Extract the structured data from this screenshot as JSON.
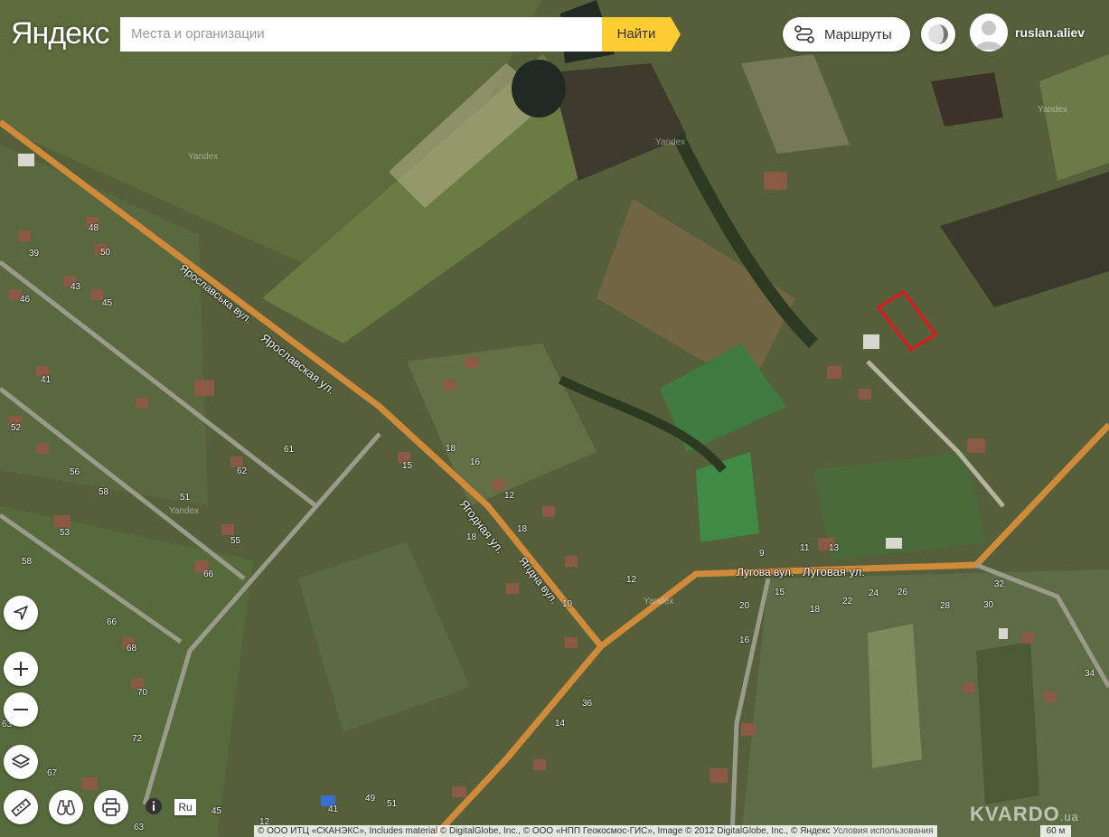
{
  "header": {
    "logo": "Яндекс",
    "search_placeholder": "Места и организации",
    "find_label": "Найти",
    "routes_label": "Маршруты",
    "username": "ruslan.aliev"
  },
  "map": {
    "streets": {
      "yaroslavska_uk": "Ярославська вул.",
      "yaroslavskaya_ru": "Ярославская ул.",
      "yagodnaya_ru": "Ягодная ул.",
      "yagidna_uk": "Ягідна вул.",
      "luhova_uk": "Лугова вул.",
      "lugovaya_ru": "Луговая ул."
    },
    "watermark": "Yandex",
    "house_numbers": [
      "39",
      "48",
      "50",
      "46",
      "43",
      "45",
      "41",
      "52",
      "56",
      "58",
      "51",
      "62",
      "61",
      "55",
      "66",
      "53",
      "58",
      "66",
      "68",
      "70",
      "72",
      "63",
      "67",
      "18",
      "15",
      "16",
      "18",
      "12",
      "18",
      "10",
      "12",
      "9",
      "11",
      "13",
      "15",
      "20",
      "16",
      "18",
      "22",
      "24",
      "26",
      "28",
      "30",
      "32",
      "34",
      "36",
      "14",
      "12",
      "45",
      "41",
      "49",
      "51",
      "63",
      "18"
    ]
  },
  "controls": {
    "locate_icon": "arrow-icon",
    "zoom_in": "+",
    "zoom_out": "−",
    "layers_icon": "layers-icon",
    "ruler_icon": "ruler-icon",
    "panorama_icon": "binoculars-icon",
    "print_icon": "printer-icon",
    "info_icon": "info-icon",
    "lang": "Ru"
  },
  "footer": {
    "copyright": "© ООО ИТЦ «СКАНЭКС», Includes material © DigitalGlobe, Inc., © ООО «НПП Геокосмос-ГИС», Image © 2012 DigitalGlobe, Inc., © Яндекс",
    "terms": "Условия использования",
    "scale": "60 м",
    "brand": "KVARDO",
    "brand_suffix": ".ua"
  },
  "colors": {
    "accent": "#ffcc33",
    "road": "#d08a3a",
    "plot_outline": "#e8141b"
  }
}
